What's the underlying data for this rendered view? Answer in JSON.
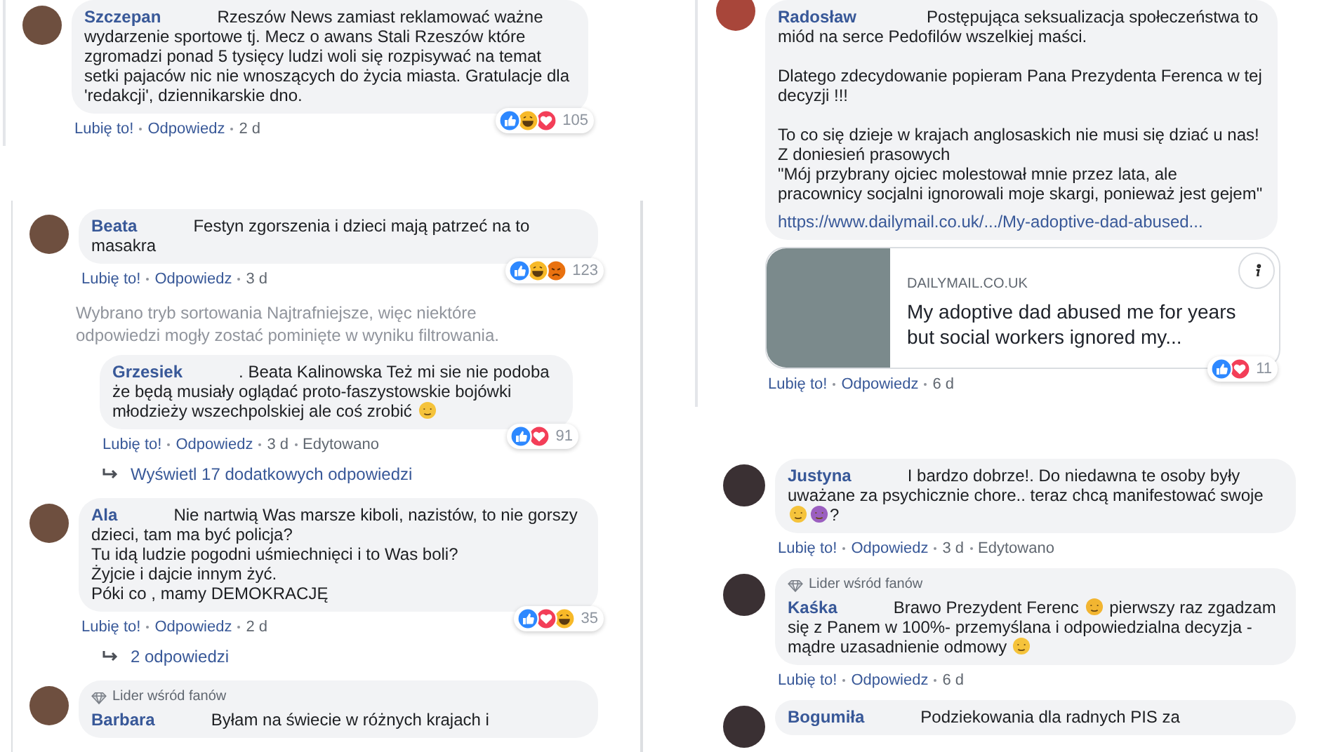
{
  "panels": [
    {
      "items": [
        {
          "kind": "comment",
          "author": "Szczepan",
          "avatar": true,
          "text": [
            "Rzeszów News zamiast reklamować ważne wydarzenie sportowe tj. Mecz o awans Stali Rzeszów które zgromadzi ponad 5 tysięcy ludzi woli się rozpisywać na temat setki pajaców nic nie wnoszących do życia miasta. Gratulacje dla 'redakcji', dziennikarskie dno."
          ],
          "reactions": {
            "kinds": [
              {
                "kind": "like"
              },
              {
                "kind": "haha"
              },
              {
                "kind": "love"
              }
            ],
            "count": "105"
          },
          "actions": {
            "like": "Lubię to!",
            "reply": "Odpowiedz",
            "time": "2 d"
          }
        }
      ]
    },
    {
      "items": [
        {
          "kind": "comment",
          "author": "Beata",
          "avatar": true,
          "text": [
            "Festyn zgorszenia i dzieci mają patrzeć na to masakra"
          ],
          "reactions": {
            "kinds": [
              {
                "kind": "like"
              },
              {
                "kind": "haha"
              },
              {
                "kind": "angry"
              }
            ],
            "count": "123"
          },
          "actions": {
            "like": "Lubię to!",
            "reply": "Odpowiedz",
            "time": "3 d"
          },
          "children": [
            {
              "kind": "notice",
              "text": "Wybrano tryb sortowania Najtrafniejsze, więc niektóre odpowiedzi mogły zostać pominięte w wyniku filtrowania."
            },
            {
              "kind": "comment",
              "author": "Grzesiek",
              "avatar": false,
              "text": [
                ". Beata Kalinowska Też mi sie nie podoba że będą musiały oglądać proto-faszystowskie bojówki młodzieży wszechpolskiej ale coś zrobić ",
                {
                  "kind": "emoji",
                  "color": "#f5c33b"
                }
              ],
              "reactions": {
                "kinds": [
                  {
                    "kind": "like"
                  },
                  {
                    "kind": "love"
                  }
                ],
                "count": "91"
              },
              "actions": {
                "like": "Lubię to!",
                "reply": "Odpowiedz",
                "time": "3 d",
                "edited": "Edytowano"
              }
            }
          ]
        },
        {
          "kind": "more",
          "text": "Wyświetl 17 dodatkowych odpowiedzi"
        },
        {
          "kind": "comment",
          "author": "Ala",
          "avatar": true,
          "text": [
            "Nie nartwią Was marsze kiboli, nazistów, to nie gorszy dzieci, tam ma być policja?\nTu idą ludzie pogodni uśmiechnięci i to Was boli?\nŻyjcie i dajcie innym żyć.\nPóki co , mamy DEMOKRACJĘ"
          ],
          "reactions": {
            "kinds": [
              {
                "kind": "like"
              },
              {
                "kind": "love"
              },
              {
                "kind": "haha"
              }
            ],
            "count": "35"
          },
          "actions": {
            "like": "Lubię to!",
            "reply": "Odpowiedz",
            "time": "2 d"
          }
        },
        {
          "kind": "more",
          "text": "2 odpowiedzi"
        },
        {
          "kind": "comment",
          "author": "Barbara",
          "avatar": true,
          "badge": "Lider wśród fanów",
          "text": [
            "Byłam na świecie w różnych krajach i"
          ]
        }
      ]
    },
    {
      "items": [
        {
          "kind": "comment",
          "author": "Radosław",
          "avatar": true,
          "text": [
            "Postępująca seksualizacja społeczeństwa to miód na serce Pedofilów wszelkiej maści.\n\nDlatego zdecydowanie popieram Pana Prezydenta Ferenca w tej decyzji !!!\n\nTo co się dzieje w krajach anglosaskich nie musi się dziać u nas!\nZ doniesień prasowych\n\"Mój przybrany ojciec molestował mnie przez lata, ale pracownicy socjalni ignorowali moje skargi, ponieważ jest gejem\""
          ],
          "link": "https://www.dailymail.co.uk/.../My-adoptive-dad-abused...",
          "preview": {
            "domain": "DAILYMAIL.CO.UK",
            "title": "My adoptive dad abused me for years but social workers ignored my..."
          },
          "reactions": {
            "kinds": [
              {
                "kind": "like"
              },
              {
                "kind": "love"
              }
            ],
            "count": "11"
          },
          "actions": {
            "like": "Lubię to!",
            "reply": "Odpowiedz",
            "time": "6 d"
          }
        }
      ]
    },
    {
      "items": [
        {
          "kind": "comment",
          "author": "Justyna",
          "avatar": true,
          "text": [
            "I bardzo dobrze!. Do niedawna te osoby były uważane za psychicznie chore.. teraz chcą manifestować swoje ",
            {
              "kind": "emoji",
              "color": "#f5c33b"
            },
            {
              "kind": "emoji",
              "color": "#9b5fc0"
            },
            "?"
          ],
          "actions": {
            "like": "Lubię to!",
            "reply": "Odpowiedz",
            "time": "3 d",
            "edited": "Edytowano"
          }
        },
        {
          "kind": "comment",
          "author": "Kaśka",
          "avatar": true,
          "badge": "Lider wśród fanów",
          "text": [
            "Brawo Prezydent Ferenc ",
            {
              "kind": "emoji",
              "color": "#f2b531"
            },
            " pierwszy raz zgadzam się z Panem w 100%- przemyślana i odpowiedzialna decyzja - mądre uzasadnienie odmowy ",
            {
              "kind": "emoji",
              "color": "#f5c33b"
            }
          ],
          "actions": {
            "like": "Lubię to!",
            "reply": "Odpowiedz",
            "time": "6 d"
          }
        },
        {
          "kind": "comment",
          "author": "Bogumiła",
          "avatar": true,
          "text": [
            "Podziekowania dla radnych PIS za"
          ]
        }
      ]
    }
  ]
}
